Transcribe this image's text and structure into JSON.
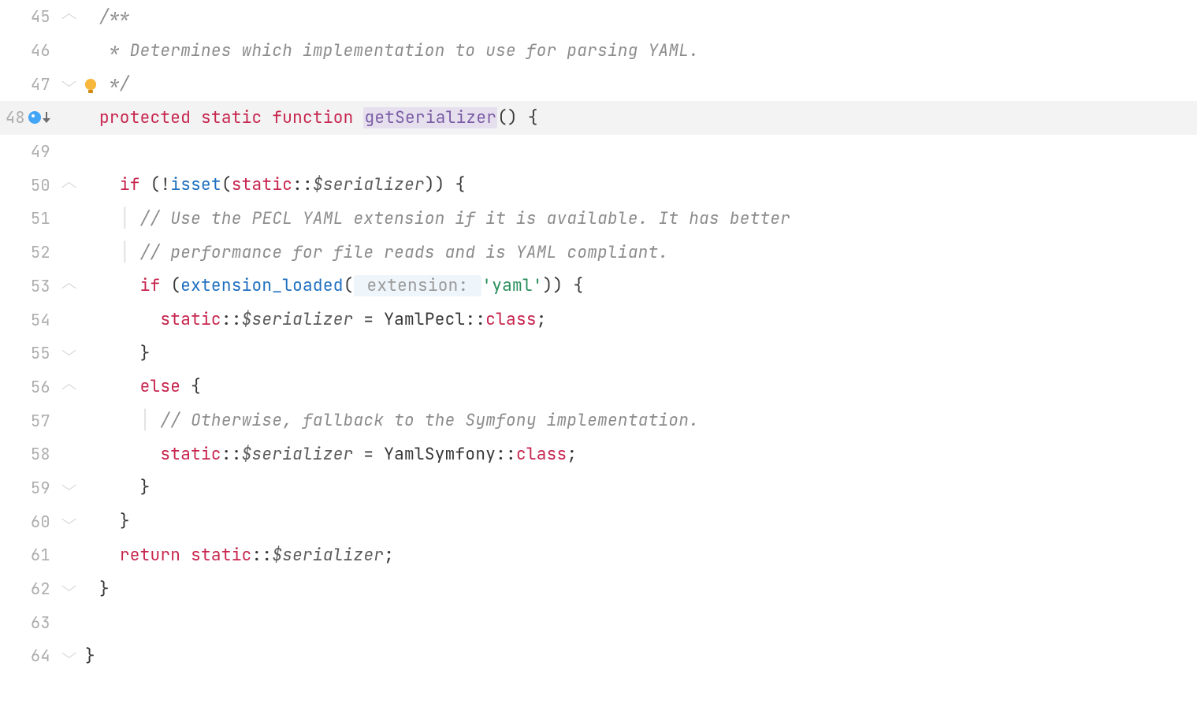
{
  "lines": {
    "45": "45",
    "46": "46",
    "47": "47",
    "48": "48",
    "49": "49",
    "50": "50",
    "51": "51",
    "52": "52",
    "53": "53",
    "54": "54",
    "55": "55",
    "56": "56",
    "57": "57",
    "58": "58",
    "59": "59",
    "60": "60",
    "61": "61",
    "62": "62",
    "63": "63",
    "64": "64"
  },
  "tok": {
    "doc_open": "/**",
    "doc_body": " * Determines which implementation to use for parsing YAML.",
    "doc_close": " */",
    "kw_protected": "protected",
    "kw_static": "static",
    "kw_function": "function",
    "fn_name": "getSerializer",
    "parens_empty": "()",
    "brace_open": "{",
    "brace_close": "}",
    "kw_if": "if",
    "bang": "!",
    "fn_isset": "isset",
    "paren_open": "(",
    "paren_close": ")",
    "dcolon": "::",
    "var_serializer": "$serializer",
    "cmt_pecl1": "// Use the PECL YAML extension if it is available. It has better",
    "cmt_pecl2": "// performance for file reads and is YAML compliant.",
    "fn_ext_loaded": "extension_loaded",
    "hint_ext": " extension: ",
    "str_yaml": "'yaml'",
    "eq": " = ",
    "cls_yamlpecl": "YamlPecl",
    "kw_class": "class",
    "semi": ";",
    "kw_else": "else",
    "cmt_symfony": "// Otherwise, fallback to the Symfony implementation.",
    "cls_yamlsymfony": "YamlSymfony",
    "kw_return": "return"
  }
}
